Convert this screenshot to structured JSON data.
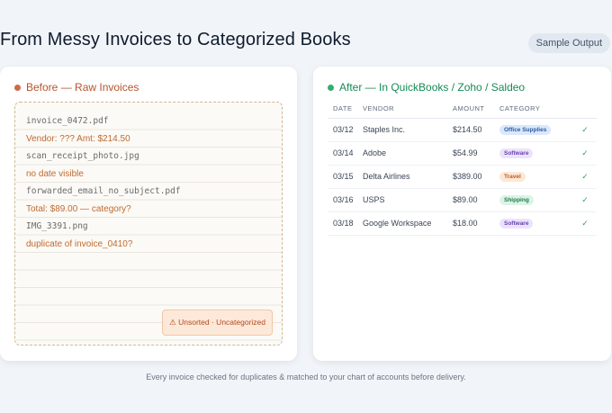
{
  "header": {
    "title": "From Messy Invoices to Categorized Books",
    "badge": "Sample Output"
  },
  "before": {
    "title": "Before — Raw Invoices",
    "items": [
      {
        "text": "invoice_0472.pdf",
        "kind": "file"
      },
      {
        "text": "Vendor: ??? Amt: $214.50",
        "kind": "note"
      },
      {
        "text": "scan_receipt_photo.jpg",
        "kind": "file"
      },
      {
        "text": "no date visible",
        "kind": "note"
      },
      {
        "text": "forwarded_email_no_subject.pdf",
        "kind": "file"
      },
      {
        "text": "Total: $89.00 — category?",
        "kind": "note"
      },
      {
        "text": "IMG_3391.png",
        "kind": "file"
      },
      {
        "text": "duplicate of invoice_0410?",
        "kind": "note"
      }
    ],
    "status": "⚠ Unsorted · Uncategorized"
  },
  "after": {
    "title": "After — In QuickBooks / Zoho / Saldeo",
    "columns": [
      "DATE",
      "VENDOR",
      "AMOUNT",
      "CATEGORY"
    ],
    "rows": [
      {
        "date": "03/12",
        "vendor": "Staples Inc.",
        "amount": "$214.50",
        "category": "Office Supplies",
        "tag": "office",
        "check": "✓"
      },
      {
        "date": "03/14",
        "vendor": "Adobe",
        "amount": "$54.99",
        "category": "Software",
        "tag": "software",
        "check": "✓"
      },
      {
        "date": "03/15",
        "vendor": "Delta Airlines",
        "amount": "$389.00",
        "category": "Travel",
        "tag": "travel",
        "check": "✓"
      },
      {
        "date": "03/16",
        "vendor": "USPS",
        "amount": "$89.00",
        "category": "Shipping",
        "tag": "shipping",
        "check": "✓"
      },
      {
        "date": "03/18",
        "vendor": "Google Workspace",
        "amount": "$18.00",
        "category": "Software",
        "tag": "software",
        "check": "✓"
      }
    ]
  },
  "footer": {
    "caption": "Every invoice checked for duplicates & matched to your chart of accounts before delivery."
  },
  "colors": {
    "before_accent": "#cf6a4a",
    "after_accent": "#2fb06d",
    "background": "#f1f4f8"
  }
}
